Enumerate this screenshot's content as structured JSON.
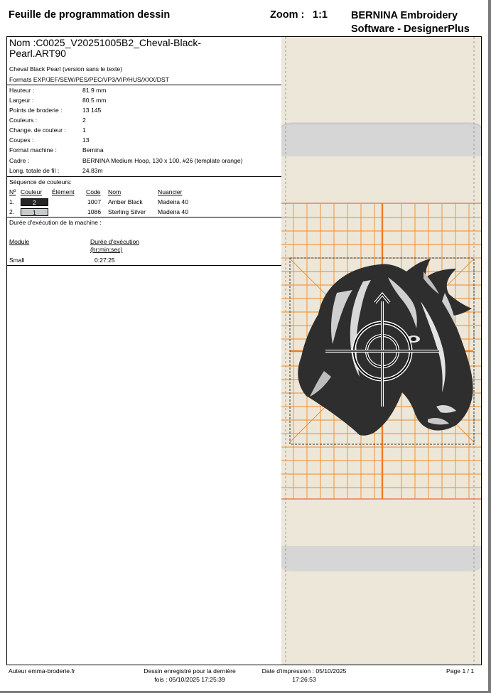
{
  "header": {
    "title": "Feuille de programmation dessin",
    "zoom_label": "Zoom :",
    "zoom_value": "1:1",
    "brand_line1": "BERNINA Embroidery",
    "brand_line2": "Software - DesignerPlus"
  },
  "design": {
    "name_line1": "Nom  :C0025_V20251005B2_Cheval-Black-",
    "name_line2": "Pearl.ART90",
    "description": "Cheval Black Pearl (version sans le texte)",
    "formats": "Formats EXP/JEF/SEW/PES/PEC/VP3/VIP/HUS/XXX/DST"
  },
  "properties": [
    {
      "key": "Hauteur :",
      "value": "81.9 mm"
    },
    {
      "key": "Largeur :",
      "value": "80.5 mm"
    },
    {
      "key": "Points de broderie :",
      "value": "13 145"
    },
    {
      "key": "Couleurs :",
      "value": "2"
    },
    {
      "key": "Change. de couleur :",
      "value": "1"
    },
    {
      "key": "Coupes :",
      "value": "13"
    },
    {
      "key": "Format machine :",
      "value": "Bernina"
    },
    {
      "key": "Cadre :",
      "value": "BERNINA Medium Hoop, 130 x 100, #26 (template orange)"
    },
    {
      "key": "Long. totale de fil :",
      "value": "24.83m"
    }
  ],
  "color_sequence": {
    "title": "Séquence de couleurs:",
    "headers": {
      "no": "Nº",
      "color": "Couleur",
      "element": "Élément",
      "code": "Code",
      "name": "Nom",
      "chart": "Nuancier"
    },
    "rows": [
      {
        "no": "1.",
        "swatch": "2",
        "swatch_color": "#262626",
        "swatch_text_color": "#ffffff",
        "code": "1007",
        "name": "Amber Black",
        "chart": "Madeira 40"
      },
      {
        "no": "2.",
        "swatch": "1",
        "swatch_color": "#c8cbcb",
        "swatch_text_color": "#000000",
        "code": "1086",
        "name": "Sterling Silver",
        "chart": "Madeira 40"
      }
    ]
  },
  "duration": {
    "title": "Durée d'exécution de la machine :",
    "module_header": "Module",
    "time_header_line1": "Durée d'exécution",
    "time_header_line2": "(hr:min:sec)",
    "rows": [
      {
        "module": "Small",
        "time": "0:27:25"
      }
    ]
  },
  "footer": {
    "author": "Auteur emma-broderie.fr",
    "saved_line1": "Dessin enregistré pour la dernière",
    "saved_line2": "fois : 05/10/2025 17:25:39",
    "printed_line1": "Date d'impression : 05/10/2025",
    "printed_line2": "17:26:53",
    "page": "Page 1 / 1"
  },
  "preview": {
    "background_color": "#ece7d8",
    "grid_color": "#f28a2a",
    "hoop_color": "#d6d6d6",
    "thread_dark": "#2e2e2e",
    "thread_light": "#d8d8d8",
    "icon": "horse-head-embroidery"
  }
}
